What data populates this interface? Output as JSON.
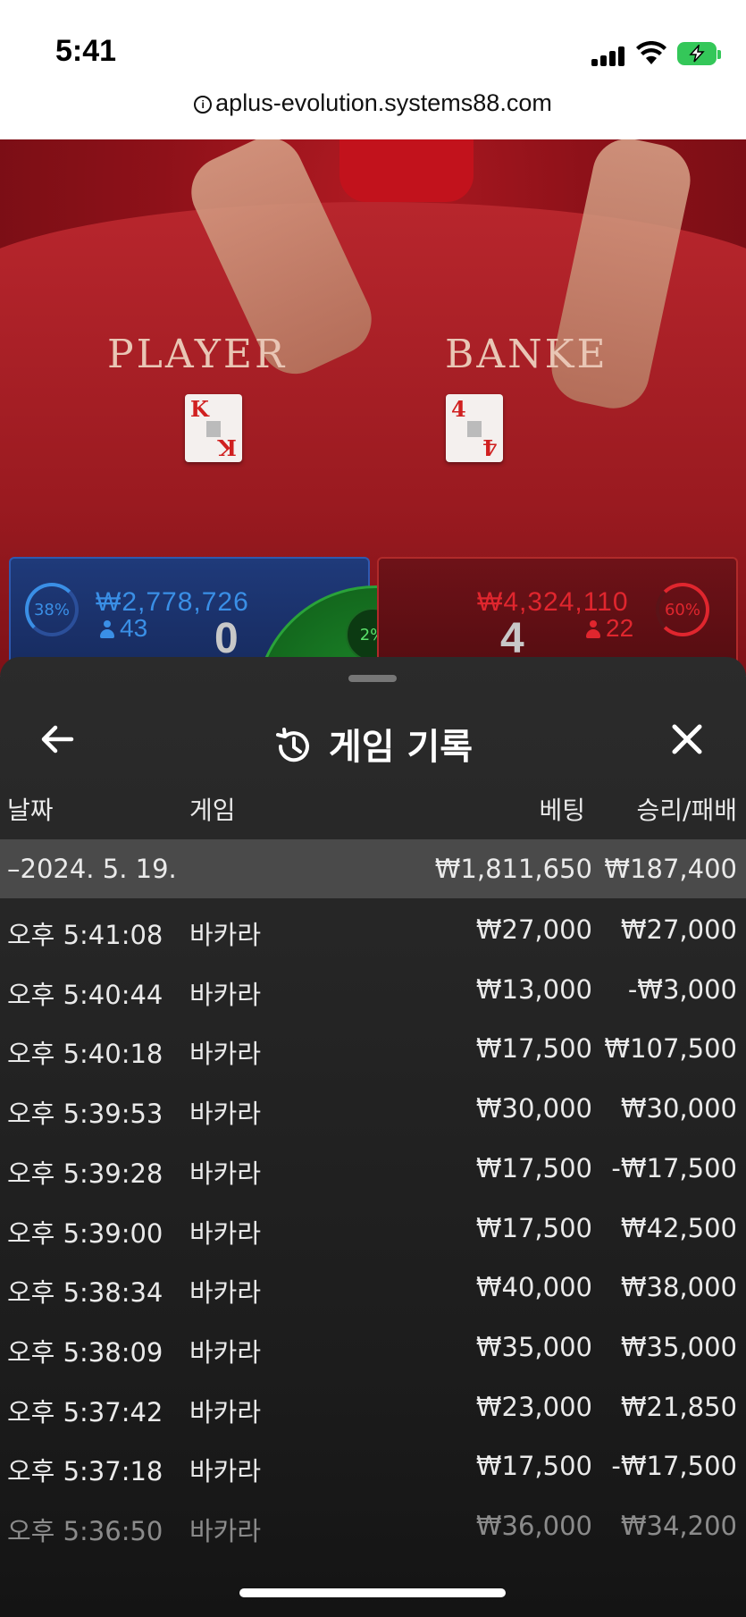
{
  "status_bar": {
    "time": "5:41"
  },
  "browser": {
    "url": "aplus-evolution.systems88.com"
  },
  "live_table": {
    "player_label": "PLAYER",
    "banker_label": "BANKE",
    "player_card": "K",
    "banker_card": "4"
  },
  "betting": {
    "player": {
      "percent": "38%",
      "amount": "₩2,778,726",
      "players": "43",
      "score": "0"
    },
    "tie": {
      "percent": "2%"
    },
    "banker": {
      "percent": "60%",
      "amount": "₩4,324,110",
      "players": "22",
      "score": "4"
    }
  },
  "history": {
    "title": "게임 기록",
    "columns": {
      "date": "날짜",
      "game": "게임",
      "bet": "베팅",
      "win_loss": "승리/패배"
    },
    "date_group": {
      "date": "–2024. 5. 19.",
      "bet": "₩1,811,650",
      "win_loss": "₩187,400"
    },
    "rows": [
      {
        "time": "오후 5:41:08",
        "game": "바카라",
        "bet": "₩27,000",
        "win_loss": "₩27,000"
      },
      {
        "time": "오후 5:40:44",
        "game": "바카라",
        "bet": "₩13,000",
        "win_loss": "-₩3,000"
      },
      {
        "time": "오후 5:40:18",
        "game": "바카라",
        "bet": "₩17,500",
        "win_loss": "₩107,500"
      },
      {
        "time": "오후 5:39:53",
        "game": "바카라",
        "bet": "₩30,000",
        "win_loss": "₩30,000"
      },
      {
        "time": "오후 5:39:28",
        "game": "바카라",
        "bet": "₩17,500",
        "win_loss": "-₩17,500"
      },
      {
        "time": "오후 5:39:00",
        "game": "바카라",
        "bet": "₩17,500",
        "win_loss": "₩42,500"
      },
      {
        "time": "오후 5:38:34",
        "game": "바카라",
        "bet": "₩40,000",
        "win_loss": "₩38,000"
      },
      {
        "time": "오후 5:38:09",
        "game": "바카라",
        "bet": "₩35,000",
        "win_loss": "₩35,000"
      },
      {
        "time": "오후 5:37:42",
        "game": "바카라",
        "bet": "₩23,000",
        "win_loss": "₩21,850"
      },
      {
        "time": "오후 5:37:18",
        "game": "바카라",
        "bet": "₩17,500",
        "win_loss": "-₩17,500"
      },
      {
        "time": "오후 5:36:50",
        "game": "바카라",
        "bet": "₩36,000",
        "win_loss": "₩34,200"
      }
    ]
  },
  "colors": {
    "player_blue": "#3a8fe6",
    "banker_red": "#e0262e",
    "tie_green": "#5be06a"
  }
}
